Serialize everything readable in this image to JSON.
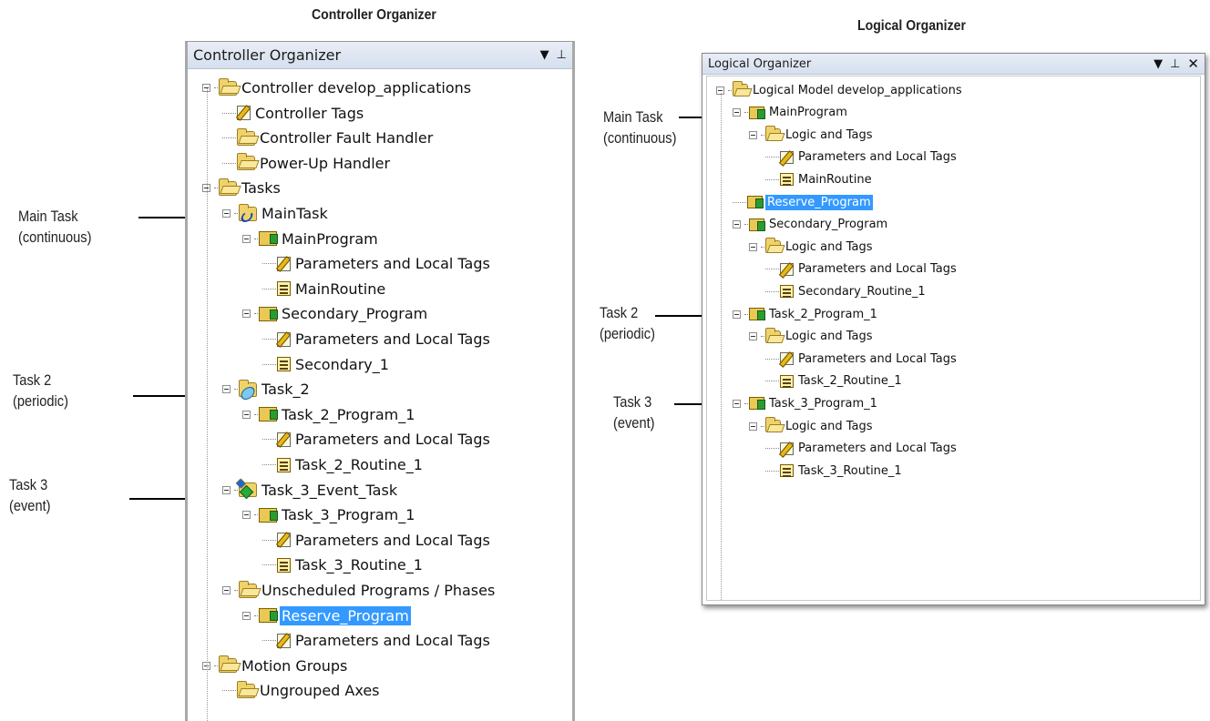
{
  "captions": {
    "controller": "Controller Organizer",
    "logical": "Logical Organizer"
  },
  "annotations": {
    "left": [
      {
        "line1": "Main Task",
        "line2": "(continuous)"
      },
      {
        "line1": "Task 2",
        "line2": "(periodic)"
      },
      {
        "line1": "Task 3",
        "line2": "(event)"
      }
    ],
    "right": [
      {
        "line1": "Main Task",
        "line2": "(continuous)"
      },
      {
        "line1": "Task 2",
        "line2": "(periodic)"
      },
      {
        "line1": "Task 3",
        "line2": "(event)"
      }
    ]
  },
  "controller_organizer": {
    "title": "Controller Organizer",
    "items": [
      {
        "label": "Controller develop_applications",
        "icon": "folder-icon"
      },
      {
        "label": "Controller Tags",
        "icon": "tags-icon"
      },
      {
        "label": "Controller Fault Handler",
        "icon": "folder-icon"
      },
      {
        "label": "Power-Up Handler",
        "icon": "folder-icon"
      },
      {
        "label": "Tasks",
        "icon": "folder-icon"
      },
      {
        "label": "MainTask",
        "icon": "continuous-task-icon"
      },
      {
        "label": "MainProgram",
        "icon": "program-icon"
      },
      {
        "label": "Parameters and Local Tags",
        "icon": "tags-icon"
      },
      {
        "label": "MainRoutine",
        "icon": "routine-icon"
      },
      {
        "label": "Secondary_Program",
        "icon": "program-icon"
      },
      {
        "label": "Parameters and Local Tags",
        "icon": "tags-icon"
      },
      {
        "label": "Secondary_1",
        "icon": "routine-icon"
      },
      {
        "label": "Task_2",
        "icon": "periodic-task-icon"
      },
      {
        "label": "Task_2_Program_1",
        "icon": "program-icon"
      },
      {
        "label": "Parameters and Local Tags",
        "icon": "tags-icon"
      },
      {
        "label": "Task_2_Routine_1",
        "icon": "routine-icon"
      },
      {
        "label": "Task_3_Event_Task",
        "icon": "event-task-icon"
      },
      {
        "label": "Task_3_Program_1",
        "icon": "program-icon"
      },
      {
        "label": "Parameters and Local Tags",
        "icon": "tags-icon"
      },
      {
        "label": "Task_3_Routine_1",
        "icon": "routine-icon"
      },
      {
        "label": "Unscheduled Programs / Phases",
        "icon": "folder-icon"
      },
      {
        "label": "Reserve_Program",
        "icon": "program-icon",
        "selected": true
      },
      {
        "label": "Parameters and Local Tags",
        "icon": "tags-icon"
      },
      {
        "label": "Motion Groups",
        "icon": "folder-icon"
      },
      {
        "label": "Ungrouped Axes",
        "icon": "folder-icon"
      }
    ]
  },
  "logical_organizer": {
    "title": "Logical Organizer",
    "items": [
      {
        "label": "Logical Model develop_applications",
        "icon": "folder-icon"
      },
      {
        "label": "MainProgram",
        "icon": "program-icon"
      },
      {
        "label": "Logic and Tags",
        "icon": "folder-icon"
      },
      {
        "label": "Parameters and Local Tags",
        "icon": "tags-icon"
      },
      {
        "label": "MainRoutine",
        "icon": "routine-icon"
      },
      {
        "label": "Reserve_Program",
        "icon": "program-icon",
        "selected": true
      },
      {
        "label": "Secondary_Program",
        "icon": "program-icon"
      },
      {
        "label": "Logic and Tags",
        "icon": "folder-icon"
      },
      {
        "label": "Parameters and Local Tags",
        "icon": "tags-icon"
      },
      {
        "label": "Secondary_Routine_1",
        "icon": "routine-icon"
      },
      {
        "label": "Task_2_Program_1",
        "icon": "program-icon"
      },
      {
        "label": "Logic and Tags",
        "icon": "folder-icon"
      },
      {
        "label": "Parameters and Local Tags",
        "icon": "tags-icon"
      },
      {
        "label": "Task_2_Routine_1",
        "icon": "routine-icon"
      },
      {
        "label": "Task_3_Program_1",
        "icon": "program-icon"
      },
      {
        "label": "Logic and Tags",
        "icon": "folder-icon"
      },
      {
        "label": "Parameters and Local Tags",
        "icon": "tags-icon"
      },
      {
        "label": "Task_3_Routine_1",
        "icon": "routine-icon"
      }
    ]
  },
  "colors": {
    "selection": "#3399ff",
    "titlebar": "#dbe4f1",
    "folder": "#f0d26a"
  }
}
